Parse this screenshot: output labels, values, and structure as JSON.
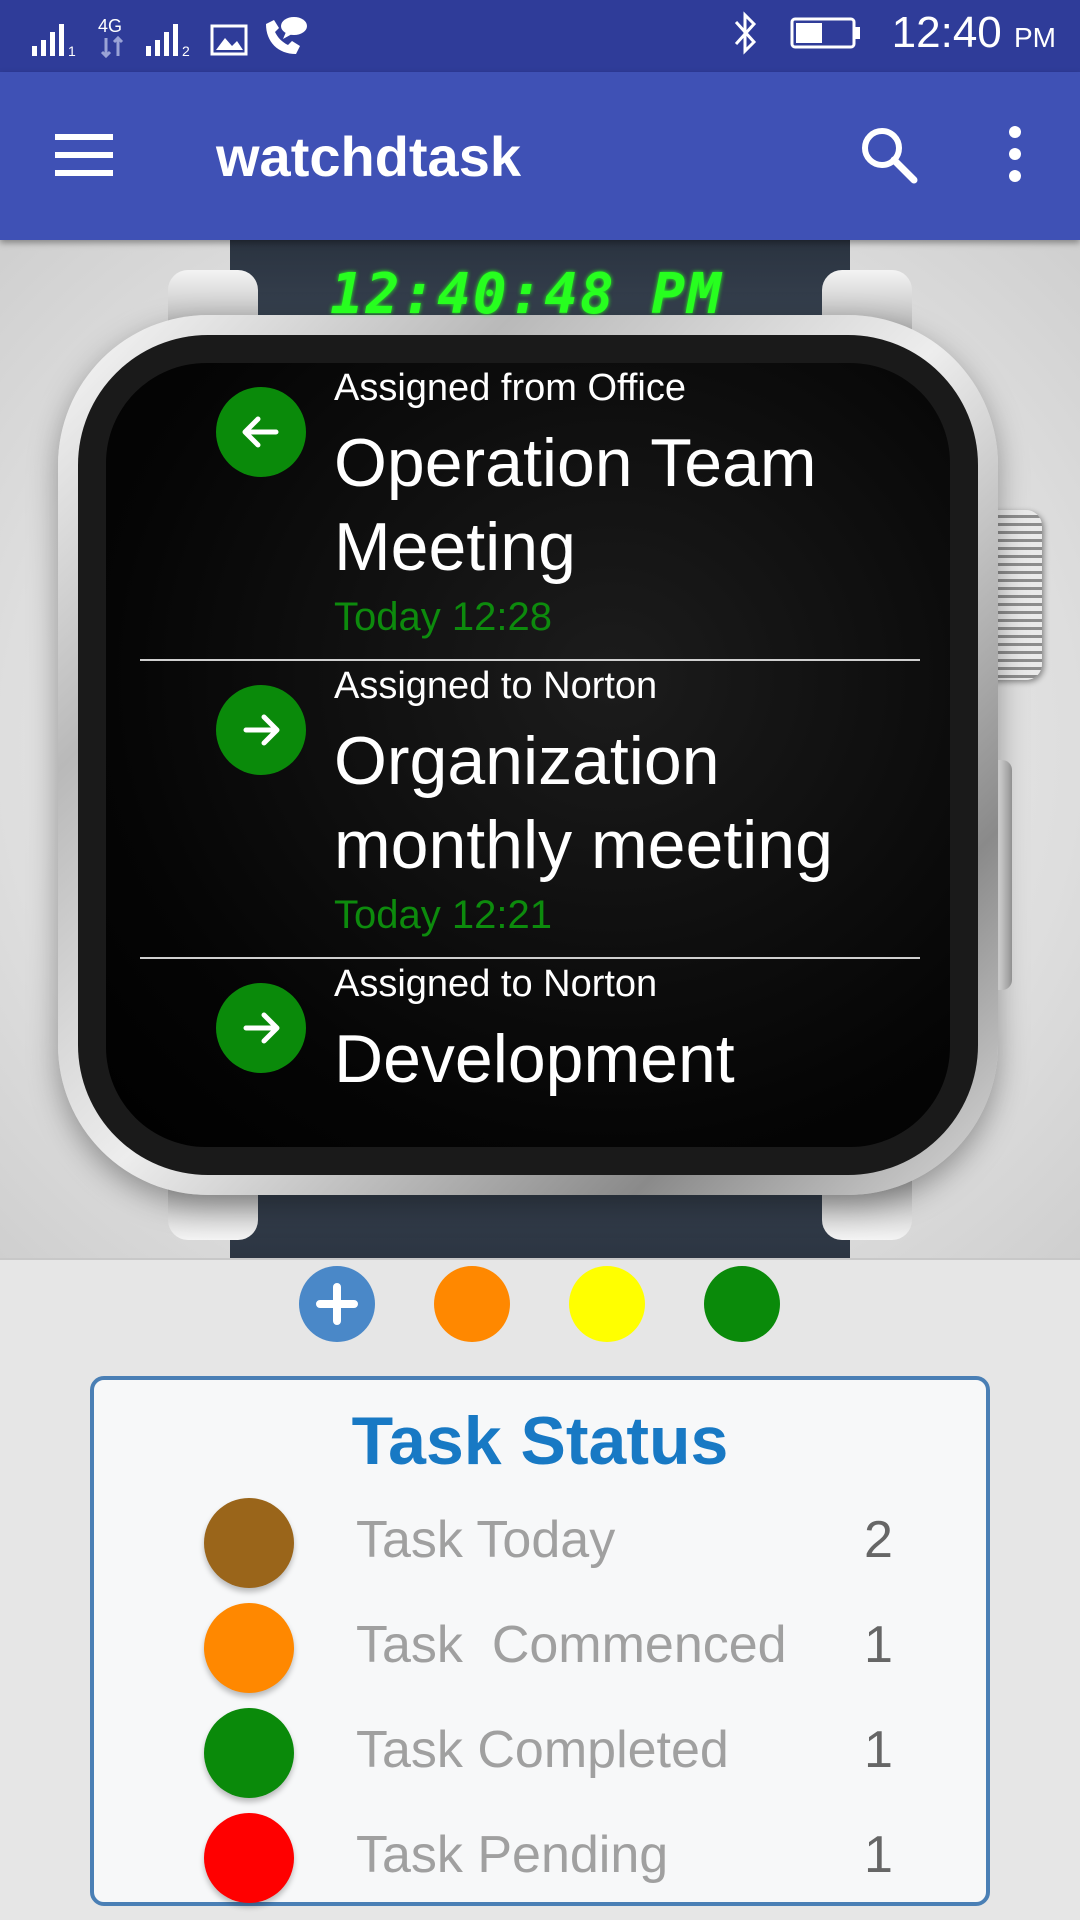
{
  "status_bar": {
    "network_4g": "4G",
    "sim1": "1",
    "sim2": "2",
    "time": "12:40",
    "ampm": "PM"
  },
  "app_bar": {
    "title": "watchdtask",
    "menu_icon": "hamburger-menu-icon",
    "search_icon": "search-icon",
    "more_icon": "more-vert-icon"
  },
  "watch": {
    "digital_clock": "12:40:48 PM",
    "tasks": [
      {
        "subtitle": "Assigned from Office",
        "title": "Operation Team Meeting",
        "time": "Today 12:28",
        "direction_icon": "arrow-left-icon"
      },
      {
        "subtitle": "Assigned to Norton",
        "title": "Organization monthly meeting",
        "time": "Today 12:21",
        "direction_icon": "arrow-right-icon"
      },
      {
        "subtitle": "Assigned to Norton",
        "title": "Development",
        "time": "",
        "direction_icon": "arrow-right-icon"
      }
    ]
  },
  "filters": [
    {
      "name": "add",
      "color": "#4a88c8",
      "icon": "plus-icon"
    },
    {
      "name": "commenced",
      "color": "#ff8800"
    },
    {
      "name": "today",
      "color": "#ffff00"
    },
    {
      "name": "completed",
      "color": "#0a8a0a"
    }
  ],
  "task_status": {
    "title": "Task Status",
    "rows": [
      {
        "label": "Task Today",
        "count": "2",
        "color": "#9a651a"
      },
      {
        "label": "Task  Commenced",
        "count": "1",
        "color": "#ff8800"
      },
      {
        "label": "Task Completed",
        "count": "1",
        "color": "#0a8a0a"
      },
      {
        "label": "Task Pending",
        "count": "1",
        "color": "#ff0000"
      }
    ]
  }
}
